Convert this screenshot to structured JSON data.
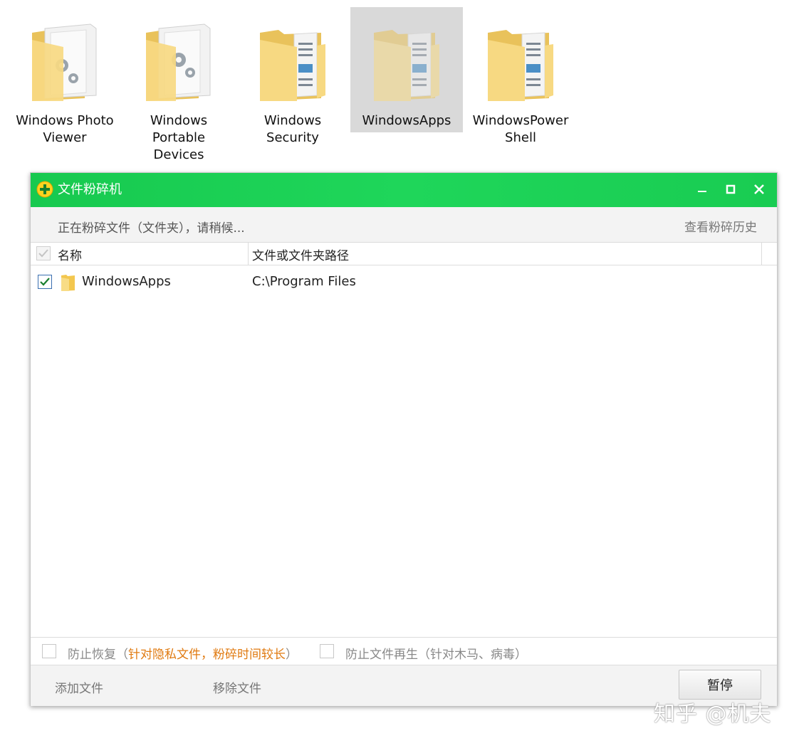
{
  "desktop": {
    "folders": [
      {
        "label_line1": "Windows Photo",
        "label_line2": "Viewer",
        "label_line3": "",
        "icon": "folder-gears-icon",
        "selected": false
      },
      {
        "label_line1": "Windows",
        "label_line2": "Portable",
        "label_line3": "Devices",
        "icon": "folder-gears-icon",
        "selected": false
      },
      {
        "label_line1": "Windows",
        "label_line2": "Security",
        "label_line3": "",
        "icon": "folder-documents-icon",
        "selected": false
      },
      {
        "label_line1": "WindowsApps",
        "label_line2": "",
        "label_line3": "",
        "icon": "folder-documents-icon",
        "selected": true
      },
      {
        "label_line1": "WindowsPower",
        "label_line2": "Shell",
        "label_line3": "",
        "icon": "folder-documents-icon",
        "selected": false
      }
    ]
  },
  "shredder": {
    "title": "文件粉碎机",
    "status": "正在粉碎文件（文件夹），请稍候...",
    "history_link": "查看粉碎历史",
    "columns": {
      "name": "名称",
      "path": "文件或文件夹路径"
    },
    "rows": [
      {
        "name": "WindowsApps",
        "path": "C:\\Program Files",
        "checked": true
      }
    ],
    "options": {
      "prevent_recovery": "防止恢复（",
      "prevent_recovery_note": "针对隐私文件，粉碎时间较长",
      "prevent_recovery_close": "）",
      "prevent_regen": "防止文件再生（针对木马、病毒）"
    },
    "buttons": {
      "add_file": "添加文件",
      "remove_file": "移除文件",
      "pause": "暂停"
    },
    "colors": {
      "titlebar": "#1fd65a",
      "accent_note": "#e07a10"
    }
  },
  "watermark": "知乎 @机夫"
}
